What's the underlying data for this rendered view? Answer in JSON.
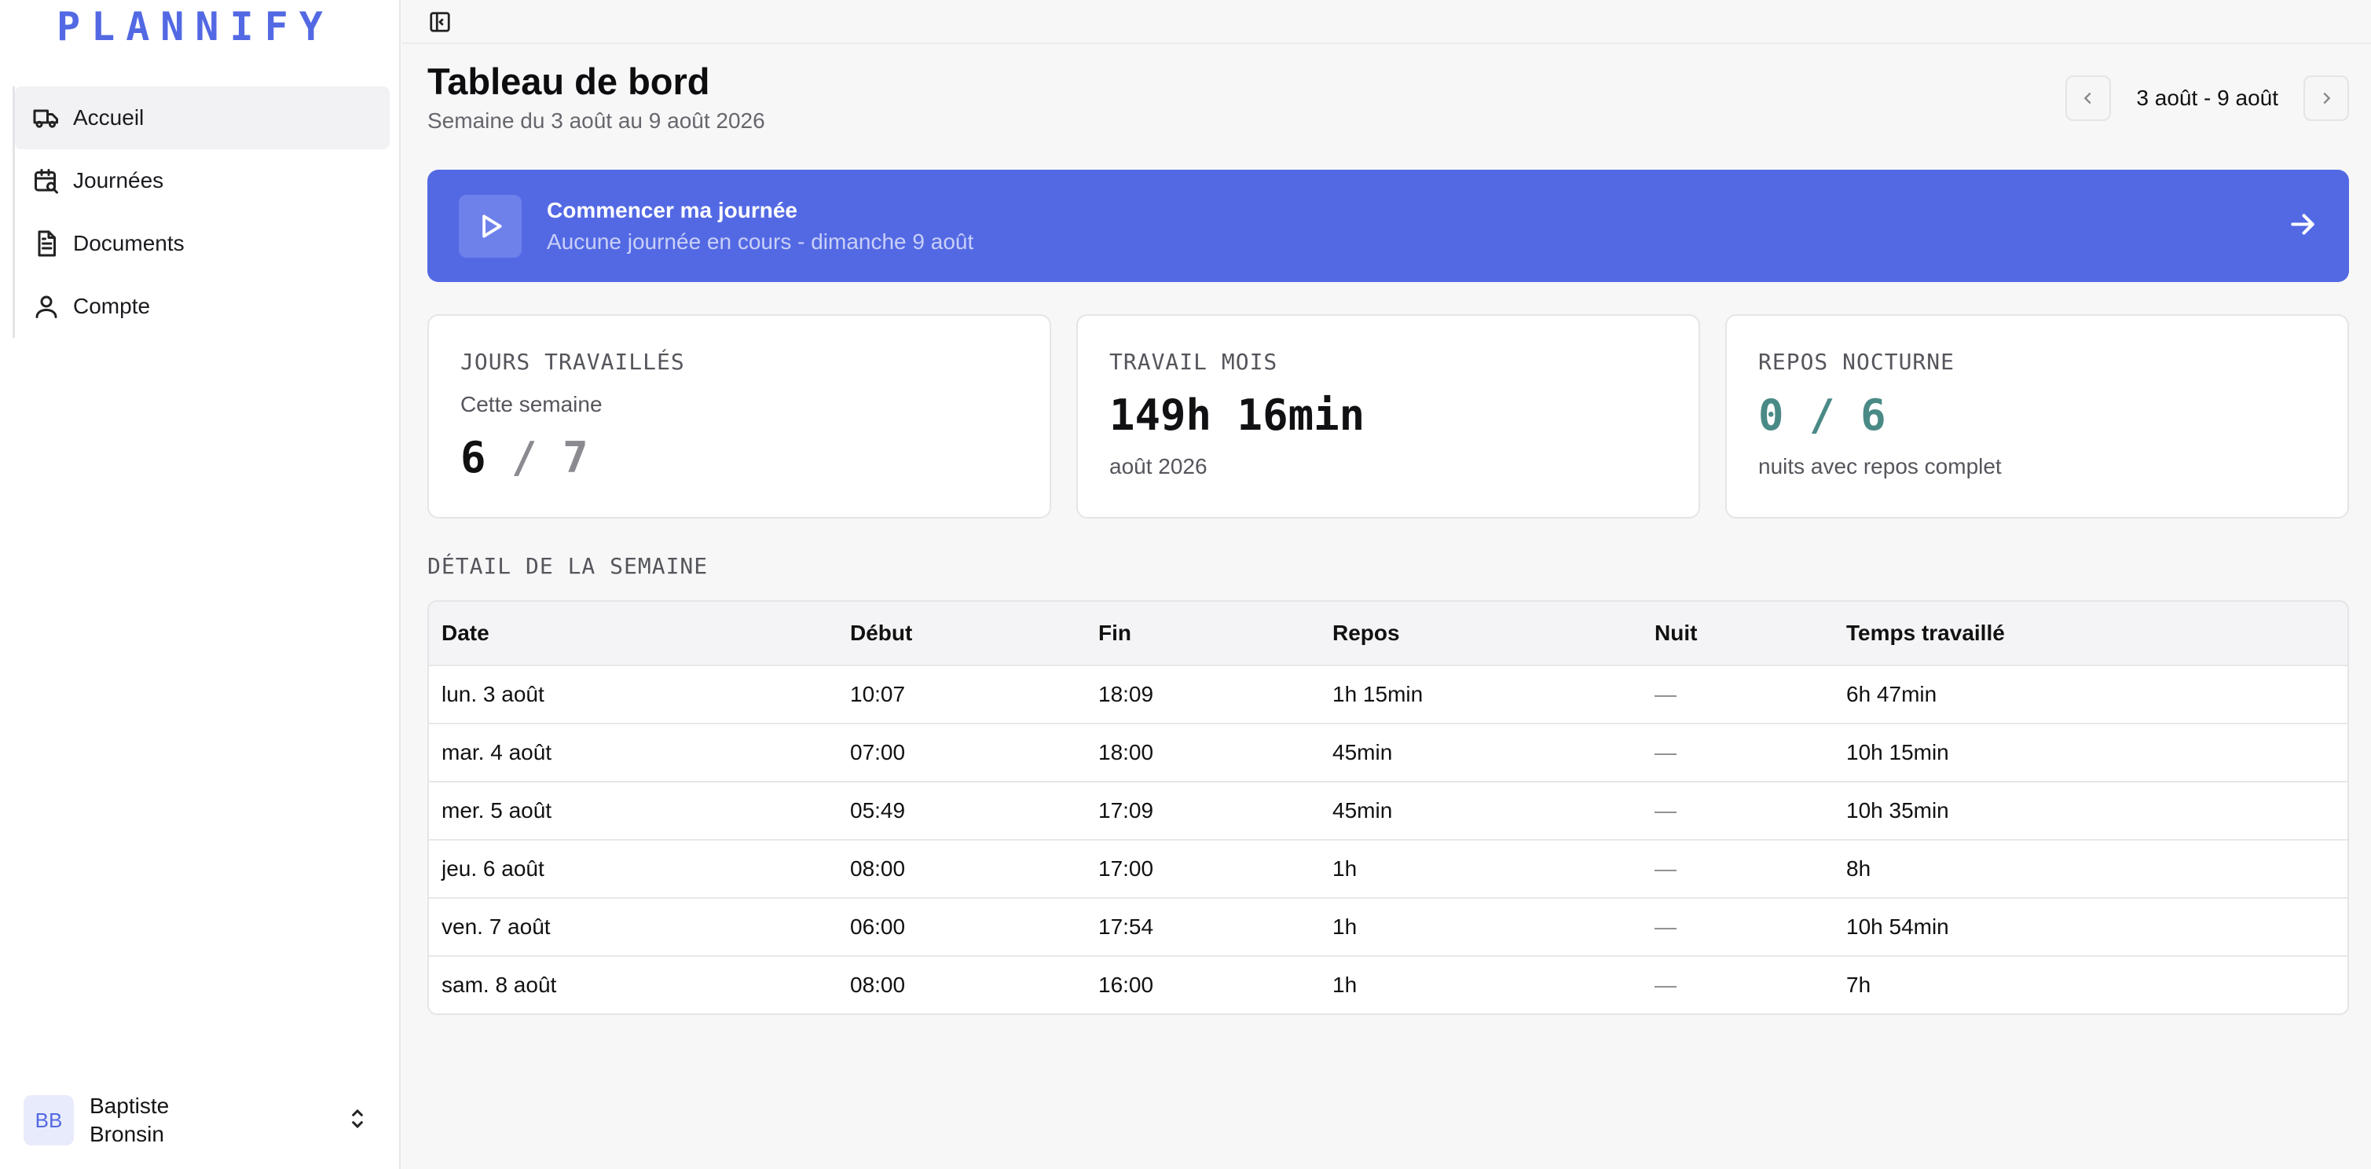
{
  "app": {
    "logo_text": "PLANNIFY",
    "brand_color": "#5369e4"
  },
  "sidebar": {
    "items": [
      {
        "label": "Accueil",
        "icon": "truck-icon",
        "active": true
      },
      {
        "label": "Journées",
        "icon": "calendar-search-icon",
        "active": false
      },
      {
        "label": "Documents",
        "icon": "document-icon",
        "active": false
      },
      {
        "label": "Compte",
        "icon": "user-icon",
        "active": false
      }
    ],
    "user": {
      "initials": "BB",
      "name": "Baptiste Bronsin"
    }
  },
  "header": {
    "title": "Tableau de bord",
    "subtitle": "Semaine du 3 août au 9 août 2026",
    "week_range": "3 août - 9 août"
  },
  "banner": {
    "title": "Commencer ma journée",
    "subtitle": "Aucune journée en cours - dimanche 9 août"
  },
  "stats": {
    "days_worked": {
      "label": "JOURS TRAVAILLÉS",
      "sub": "Cette semaine",
      "value": "6",
      "sep": "/",
      "total": "7"
    },
    "month_work": {
      "label": "TRAVAIL MOIS",
      "value": "149h 16min",
      "foot": "août 2026"
    },
    "night_rest": {
      "label": "REPOS NOCTURNE",
      "value": "0",
      "sep": "/",
      "total": "6",
      "foot": "nuits avec repos complet",
      "color": "#4a8a86"
    }
  },
  "week_detail": {
    "title": "DÉTAIL DE LA SEMAINE",
    "headers": [
      "Date",
      "Début",
      "Fin",
      "Repos",
      "Nuit",
      "Temps travaillé"
    ],
    "rows": [
      [
        "lun. 3 août",
        "10:07",
        "18:09",
        "1h 15min",
        "—",
        "6h 47min"
      ],
      [
        "mar. 4 août",
        "07:00",
        "18:00",
        "45min",
        "—",
        "10h 15min"
      ],
      [
        "mer. 5 août",
        "05:49",
        "17:09",
        "45min",
        "—",
        "10h 35min"
      ],
      [
        "jeu. 6 août",
        "08:00",
        "17:00",
        "1h",
        "—",
        "8h"
      ],
      [
        "ven. 7 août",
        "06:00",
        "17:54",
        "1h",
        "—",
        "10h 54min"
      ],
      [
        "sam. 8 août",
        "08:00",
        "16:00",
        "1h",
        "—",
        "7h"
      ]
    ]
  }
}
